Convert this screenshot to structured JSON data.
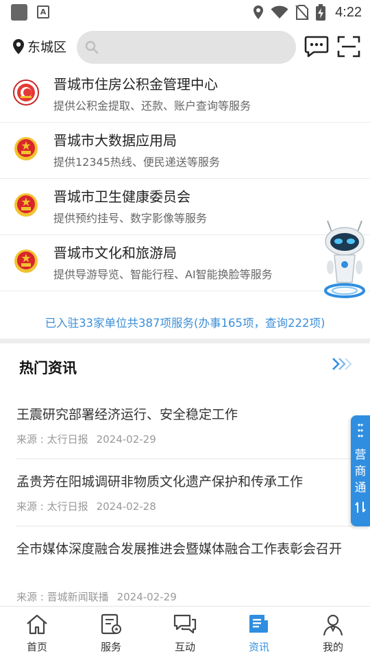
{
  "status_bar": {
    "time": "4:22",
    "icons": [
      "app-icon",
      "a-notification-icon",
      "location-icon",
      "wifi-icon",
      "no-sim-icon",
      "battery-charging-icon"
    ]
  },
  "header": {
    "location": "东城区",
    "search_placeholder": "",
    "icons": [
      "location-pin-icon",
      "search-icon",
      "message-icon",
      "scan-icon"
    ]
  },
  "org_list": [
    {
      "name": "晋城市住房公积金管理中心",
      "desc": "提供公积金提取、还款、账户查询等服务",
      "logo": "housing-fund-logo"
    },
    {
      "name": "晋城市大数据应用局",
      "desc": "提供12345热线、便民递送等服务",
      "logo": "national-emblem"
    },
    {
      "name": "晋城市卫生健康委员会",
      "desc": "提供预约挂号、数字影像等服务",
      "logo": "national-emblem"
    },
    {
      "name": "晋城市文化和旅游局",
      "desc": "提供导游导览、智能行程、AI智能换脸等服务",
      "logo": "national-emblem"
    }
  ],
  "summary": "已入驻33家单位共387项服务(办事165项，查询222项)",
  "hot_news": {
    "title": "热门资讯",
    "items": [
      {
        "title": "王震研究部署经济运行、安全稳定工作",
        "source": "来源 : 太行日报",
        "date": "2024-02-29"
      },
      {
        "title": "孟贵芳在阳城调研非物质文化遗产保护和传承工作",
        "source": "来源 : 太行日报",
        "date": "2024-02-28"
      },
      {
        "title": "全市媒体深度融合发展推进会暨媒体融合工作表彰会召开",
        "source": "来源 : 晋城新闻联播",
        "date": "2024-02-29"
      }
    ]
  },
  "side_tab": {
    "label": "营商通",
    "swap": "⇄"
  },
  "bottom_nav": [
    {
      "label": "首页",
      "icon": "home-icon",
      "active": false
    },
    {
      "label": "服务",
      "icon": "service-icon",
      "active": false
    },
    {
      "label": "互动",
      "icon": "chat-icon",
      "active": false
    },
    {
      "label": "资讯",
      "icon": "news-icon",
      "active": true
    },
    {
      "label": "我的",
      "icon": "profile-icon",
      "active": false
    }
  ],
  "colors": {
    "accent": "#2f8ee0",
    "summary_text": "#3c8fd8",
    "emblem_red": "#d8262a",
    "emblem_gold": "#f2c230"
  }
}
